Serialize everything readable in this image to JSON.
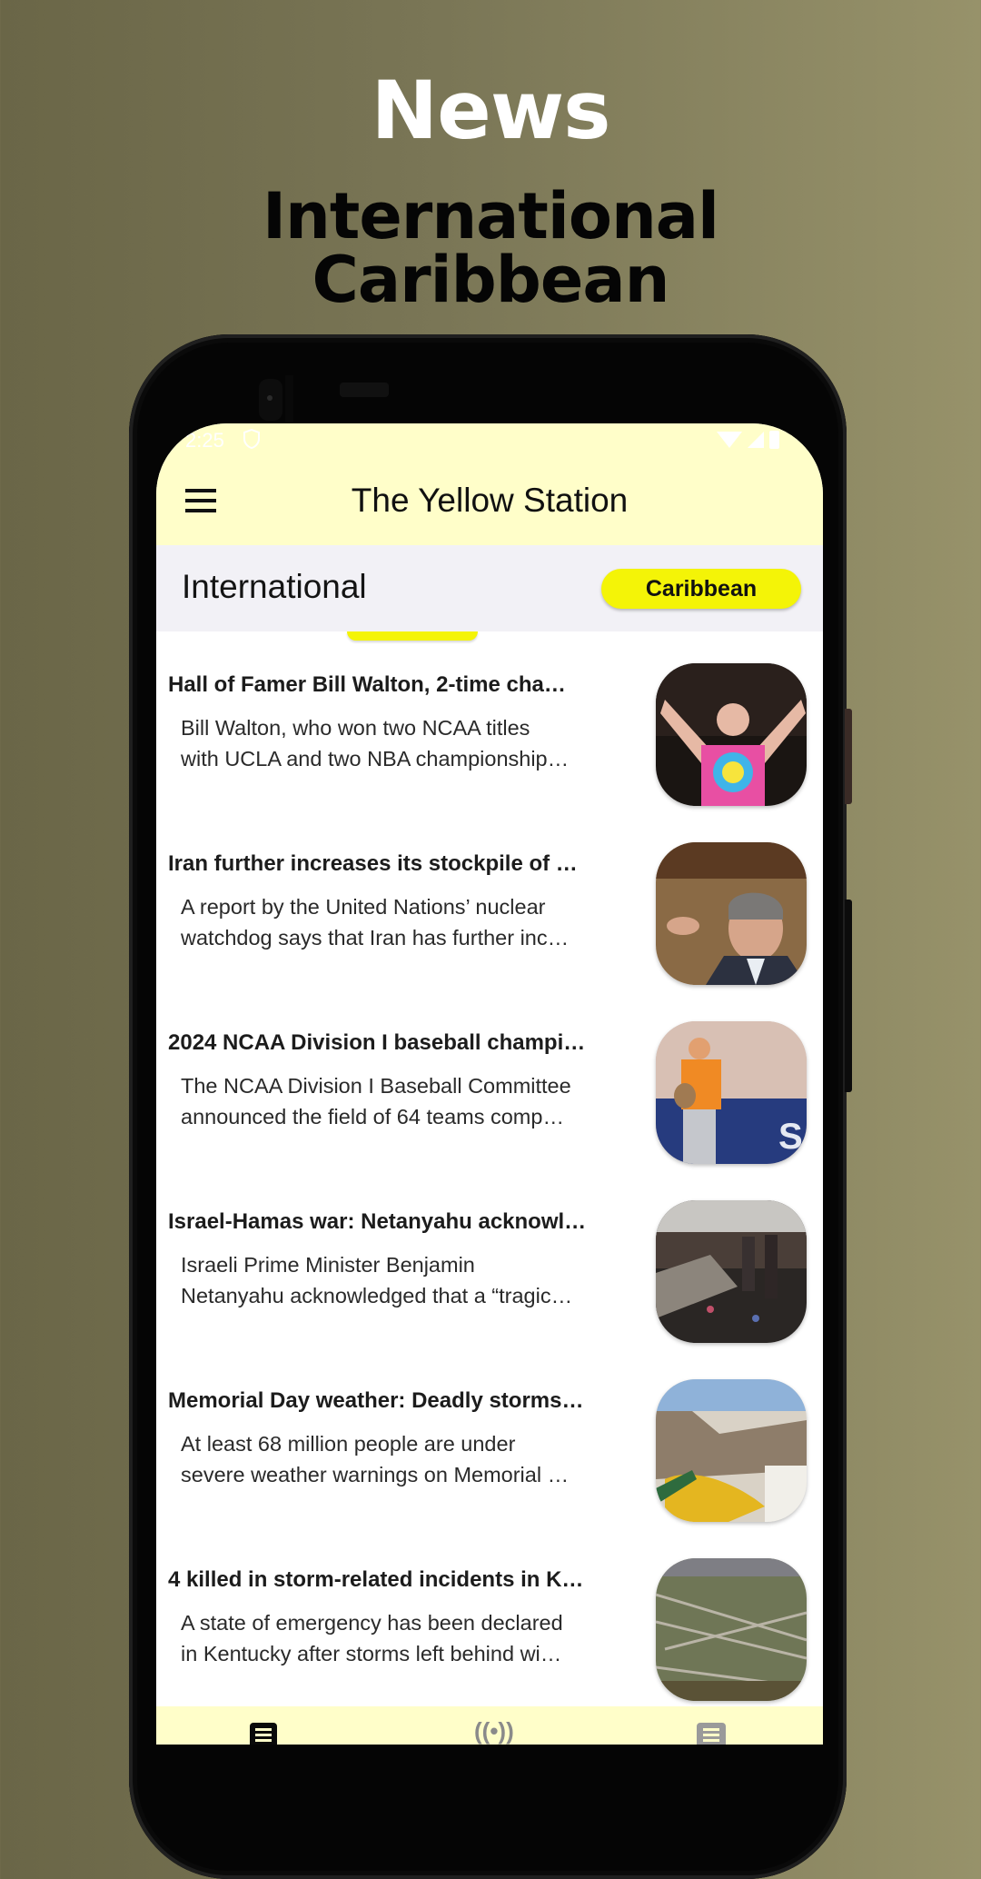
{
  "promo": {
    "title": "News",
    "subtitle_line1": "International",
    "subtitle_line2": "Caribbean"
  },
  "status_bar": {
    "time": "2:25",
    "icons": [
      "vpn-shield-icon",
      "wifi-icon",
      "signal-icon",
      "battery-icon"
    ]
  },
  "app_bar": {
    "title": "The Yellow Station",
    "menu_icon": "hamburger-menu-icon"
  },
  "category_bar": {
    "current": "International",
    "switch_button": "Caribbean"
  },
  "colors": {
    "app_bar_bg": "#fffec9",
    "accent_yellow": "#f4f407",
    "category_bar_bg": "#f2f1f6"
  },
  "articles": [
    {
      "title": "Hall of Famer Bill Walton, 2-time cha…",
      "desc_line1": "Bill Walton, who won two NCAA titles",
      "desc_line2": "with UCLA and two NBA championship…",
      "image": "bill-walton-tie-dye-photo"
    },
    {
      "title": "Iran further increases its stockpile of …",
      "desc_line1": "A report by the United Nations’ nuclear",
      "desc_line2": "watchdog says that Iran has further inc…",
      "image": "iaea-official-photo"
    },
    {
      "title": "2024 NCAA Division I baseball champi…",
      "desc_line1": "The NCAA Division I Baseball Committee",
      "desc_line2": "announced the field of 64 teams comp…",
      "image": "vols-baseball-player-photo"
    },
    {
      "title": "Israel-Hamas war: Netanyahu acknowl…",
      "desc_line1": "Israeli Prime Minister Benjamin",
      "desc_line2": "Netanyahu acknowledged that a “tragic…",
      "image": "destroyed-camp-photo"
    },
    {
      "title": "Memorial Day weather: Deadly storms…",
      "desc_line1": "At least 68 million people are under",
      "desc_line2": "severe weather warnings on Memorial …",
      "image": "storm-debris-photo"
    },
    {
      "title": "4 killed in storm-related incidents in K…",
      "desc_line1": "A state of emergency has been declared",
      "desc_line2": "in Kentucky after storms left behind wi…",
      "image": "fallen-trees-photo"
    }
  ],
  "bottom_nav": {
    "items": [
      {
        "icon": "news-article-icon",
        "active": true
      },
      {
        "icon": "radio-broadcast-icon",
        "active": false
      },
      {
        "icon": "list-menu-icon",
        "active": false
      }
    ],
    "radio_glyph": "((•))"
  }
}
